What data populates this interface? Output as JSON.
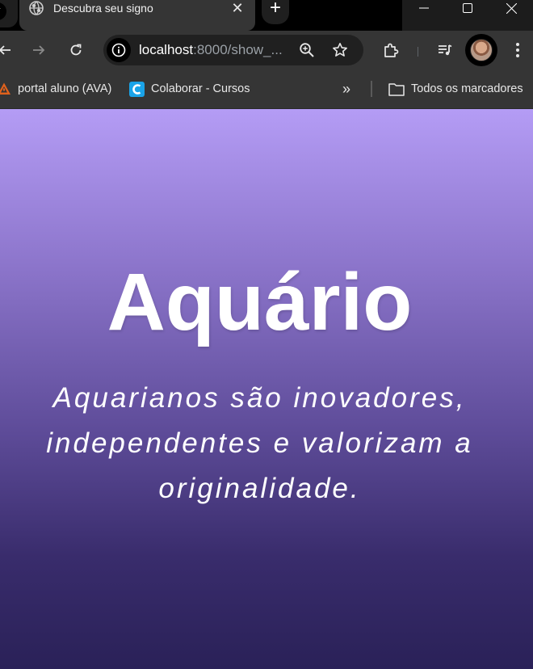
{
  "browser": {
    "tab": {
      "title": "Descubra seu signo",
      "close_glyph": "✕"
    },
    "new_tab_glyph": "+",
    "omnibox": {
      "host": "localhost",
      "path": ":8000/show_..."
    },
    "bookmarks": [
      {
        "label": "portal aluno (AVA)",
        "icon": "ava-warning-icon"
      },
      {
        "label": "Colaborar - Cursos",
        "icon": "colaborar-c-icon"
      }
    ],
    "bookmarks_overflow_glyph": "»",
    "bookmarks_folder": "Todos os marcadores"
  },
  "page": {
    "sign_name": "Aquário",
    "description": "Aquarianos são inovadores, independentes e valorizam a originalidade.",
    "gradient_top_color": "#b49cf5",
    "gradient_bottom_color": "#2a2158"
  }
}
